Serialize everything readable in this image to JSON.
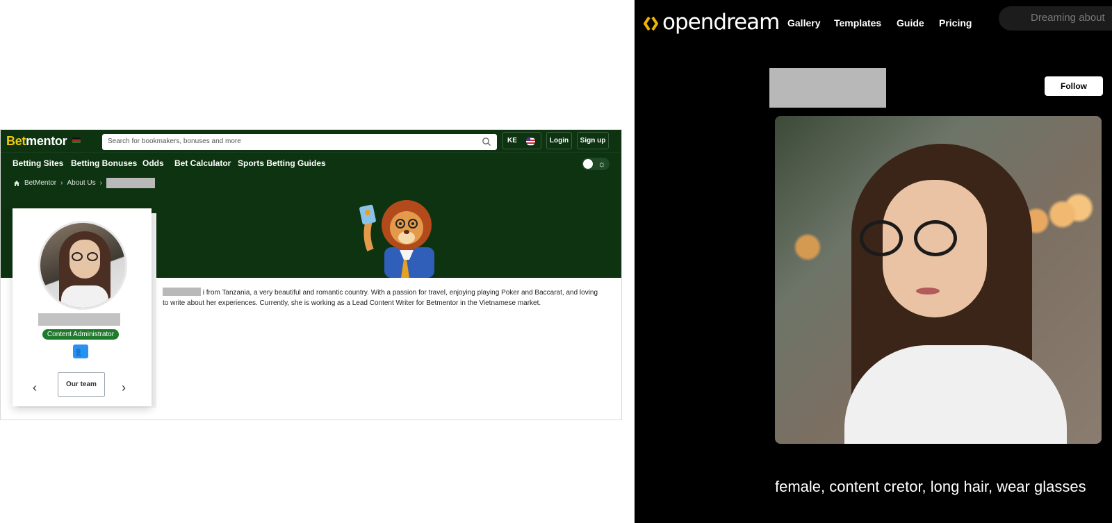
{
  "betmentor": {
    "logo_bet": "Bet",
    "logo_mentor": "mentor",
    "search_placeholder": "Search for bookmakers, bonuses and more",
    "country_code": "KE",
    "login_label": "Login",
    "signup_label": "Sign up",
    "nav": [
      "Betting Sites",
      "Betting Bonuses",
      "Odds",
      "Bet Calculator",
      "Sports Betting Guides"
    ],
    "breadcrumb": [
      "BetMentor",
      "About Us"
    ],
    "bio_text": " i from Tanzania, a very beautiful and romantic country. With a passion for travel, enjoying playing Poker and Baccarat, and loving to write about her experiences. Currently, she is working as a Lead Content Writer for Betmentor in the Vietnamese market.",
    "role_badge": "Content Administrator",
    "team_button": "Our team",
    "prev_arrow": "‹",
    "next_arrow": "›",
    "accent_color": "#0d3311",
    "brand_yellow": "#f2c811",
    "badge_color": "#1f7a2c"
  },
  "opendream": {
    "logo_text": "opendream",
    "nav": [
      "Gallery",
      "Templates",
      "Guide",
      "Pricing"
    ],
    "dream_input_placeholder": "Dreaming about",
    "follow_label": "Follow",
    "prompt_text": "female, content cretor, long hair, wear glasses",
    "logo_accent": "#f0b400"
  }
}
